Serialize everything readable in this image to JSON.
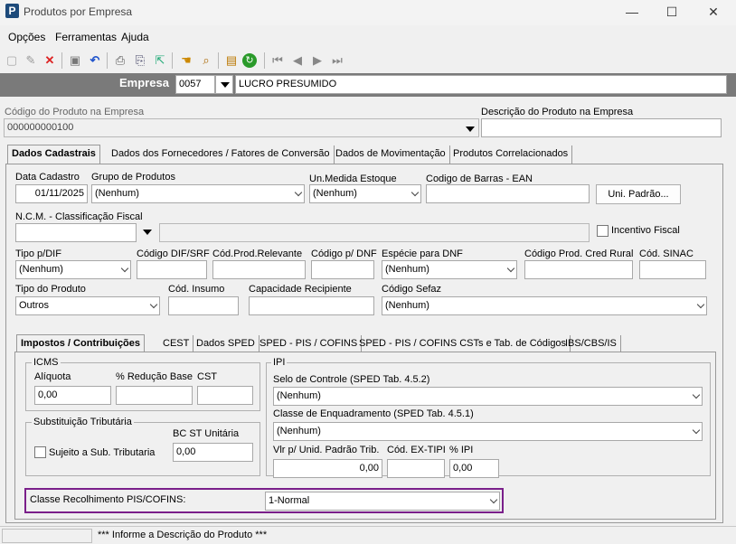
{
  "window": {
    "title": "Produtos por Empresa",
    "logo": "P",
    "minimize": "—",
    "maximize": "☐",
    "close": "✕"
  },
  "menu": [
    "Opções",
    "Ferramentas",
    "Ajuda"
  ],
  "empresa": {
    "label": "Empresa",
    "code": "0057",
    "name": "LUCRO PRESUMIDO"
  },
  "produto": {
    "codigo_label": "Código do Produto na Empresa",
    "codigo_value": "000000000100",
    "descricao_label": "Descrição do Produto na Empresa",
    "descricao_value": ""
  },
  "tabs": [
    "Dados Cadastrais",
    "Dados dos Fornecedores / Fatores de Conversão",
    "Dados de Movimentação",
    "Produtos Correlacionados"
  ],
  "cad": {
    "data_cadastro_label": "Data Cadastro",
    "data_cadastro": "01/11/2025",
    "grupo_label": "Grupo de Produtos",
    "grupo": "(Nenhum)",
    "unmed_label": "Un.Medida Estoque",
    "unmed": "(Nenhum)",
    "ean_label": "Codigo de Barras - EAN",
    "ean": "",
    "uni_padrao": "Uni. Padrão...",
    "ncm_label": "N.C.M. -  Classificação Fiscal",
    "ncm": "",
    "ncm_desc": "",
    "incentivo_label": "Incentivo Fiscal",
    "tipo_dif_label": "Tipo p/DIF",
    "tipo_dif": "(Nenhum)",
    "cod_dif_label": "Código DIF/SRF",
    "cod_rel_label": "Cód.Prod.Relevante",
    "cod_dnf_label": "Código p/ DNF",
    "esp_dnf_label": "Espécie para DNF",
    "esp_dnf": "(Nenhum)",
    "cod_rural_label": "Código Prod. Cred Rural",
    "sinac_label": "Cód. SINAC",
    "tipo_prod_label": "Tipo do Produto",
    "tipo_prod": "Outros",
    "insumo_label": "Cód. Insumo",
    "capac_label": "Capacidade Recipiente",
    "sefaz_label": "Código Sefaz",
    "sefaz": "(Nenhum)"
  },
  "subtabs": [
    "Impostos / Contribuições",
    "CEST",
    "Dados SPED",
    "SPED - PIS / COFINS",
    "SPED - PIS / COFINS CSTs e Tab. de Códigos",
    "IBS/CBS/IS"
  ],
  "icms": {
    "title": "ICMS",
    "aliq_label": "Alíquota",
    "aliq": "0,00",
    "red_label": "% Redução Base",
    "cst_label": "CST"
  },
  "st": {
    "title": "Substituição Tributária",
    "bc_label": "BC ST Unitária",
    "bc": "0,00",
    "sujeito_label": "Sujeito a Sub. Tributaria"
  },
  "ipi": {
    "title": "IPI",
    "selo_label": "Selo de Controle (SPED Tab. 4.5.2)",
    "selo": "(Nenhum)",
    "classe_label": "Classe de Enquadramento (SPED Tab. 4.5.1)",
    "classe": "(Nenhum)",
    "vlr_label": "Vlr p/ Unid. Padrão Trib.",
    "vlr": "0,00",
    "extipi_label": "Cód. EX-TIPI",
    "pct_label": "% IPI",
    "pct": "0,00"
  },
  "pis": {
    "label": "Classe Recolhimento PIS/COFINS:",
    "value": "1-Normal"
  },
  "status": "*** Informe a Descrição do Produto ***"
}
